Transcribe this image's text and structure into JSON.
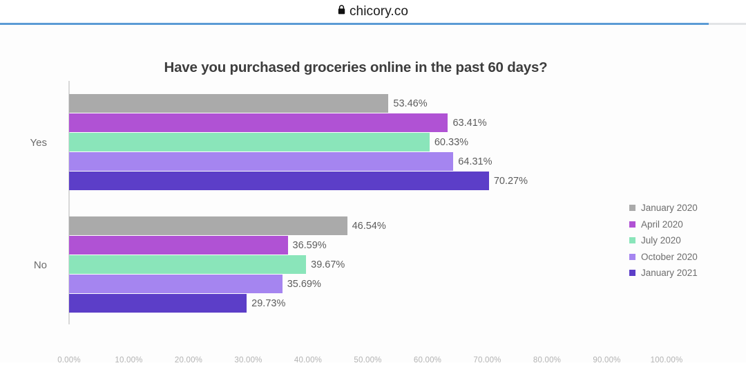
{
  "browser": {
    "url": "chicory.co",
    "lock_icon": "padlock-icon",
    "progress_percent": 95
  },
  "chart_data": {
    "type": "bar",
    "orientation": "horizontal",
    "title": "Have you purchased groceries online in the past 60 days?",
    "xlabel": "",
    "ylabel": "",
    "categories": [
      "Yes",
      "No"
    ],
    "xlim": [
      0,
      100
    ],
    "grid": false,
    "legend_position": "right",
    "value_suffix": "%",
    "xticks": [
      "0.00%",
      "10.00%",
      "20.00%",
      "30.00%",
      "40.00%",
      "50.00%",
      "60.00%",
      "70.00%",
      "80.00%",
      "90.00%",
      "100.00%"
    ],
    "xtick_values": [
      0,
      10,
      20,
      30,
      40,
      50,
      60,
      70,
      80,
      90,
      100
    ],
    "series": [
      {
        "name": "January 2020",
        "color": "#aaaaaa",
        "values": [
          53.46,
          46.54
        ],
        "labels": [
          "53.46%",
          "46.54%"
        ]
      },
      {
        "name": "April 2020",
        "color": "#b052d4",
        "values": [
          63.41,
          36.59
        ],
        "labels": [
          "63.41%",
          "36.59%"
        ]
      },
      {
        "name": "July 2020",
        "color": "#8ae5ba",
        "values": [
          60.33,
          39.67
        ],
        "labels": [
          "60.33%",
          "39.67%"
        ]
      },
      {
        "name": "October 2020",
        "color": "#a585f0",
        "values": [
          64.31,
          35.69
        ],
        "labels": [
          "64.31%",
          "35.69%"
        ]
      },
      {
        "name": "January 2021",
        "color": "#5c3ec8",
        "values": [
          70.27,
          29.73
        ],
        "labels": [
          "70.27%",
          "29.73%"
        ]
      }
    ]
  }
}
